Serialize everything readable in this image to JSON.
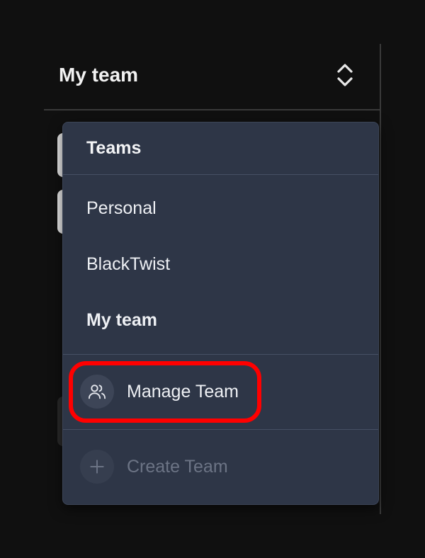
{
  "team_switcher": {
    "current_team": "My team",
    "icon": "chevrons-up-down-icon"
  },
  "dropdown": {
    "heading": "Teams",
    "teams": [
      {
        "label": "Personal",
        "selected": false
      },
      {
        "label": "BlackTwist",
        "selected": false
      },
      {
        "label": "My team",
        "selected": true
      }
    ],
    "actions": {
      "manage": {
        "label": "Manage Team",
        "icon": "users-icon"
      },
      "create": {
        "label": "Create Team",
        "icon": "plus-icon",
        "disabled": true
      }
    }
  },
  "colors": {
    "background": "#101010",
    "menu_bg": "#2e3647",
    "highlight": "#ff0000"
  }
}
